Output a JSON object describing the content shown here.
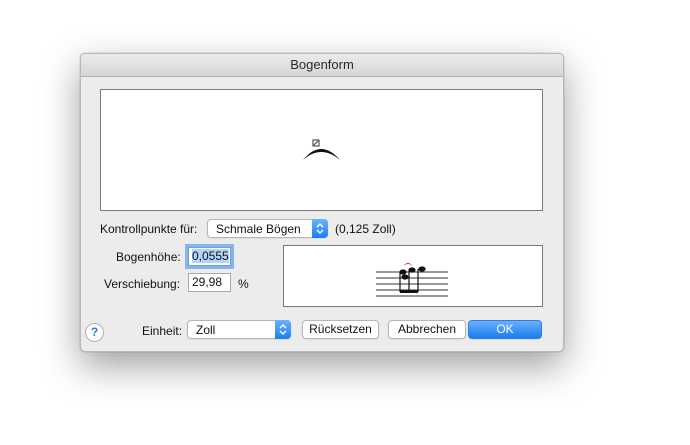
{
  "window": {
    "title": "Bogenform"
  },
  "controls": {
    "kontrollpunkte_label": "Kontrollpunkte für:",
    "kontrollpunkte_value": "Schmale Bögen",
    "kontrollpunkte_size": "(0,125 Zoll)",
    "bogenhoehe_label": "Bogenhöhe:",
    "bogenhoehe_value": "0,0555",
    "verschiebung_label": "Verschiebung:",
    "verschiebung_value": "29,98",
    "verschiebung_unit": "%",
    "einheit_label": "Einheit:",
    "einheit_value": "Zoll"
  },
  "buttons": {
    "help": "?",
    "reset": "Rücksetzen",
    "cancel": "Abbrechen",
    "ok": "OK"
  },
  "colors": {
    "accent": "#1c7ef2",
    "slur_handle": "#d9231d"
  },
  "icons": [
    "chevron-updown-icon",
    "help-icon",
    "slur-preview",
    "notes-preview"
  ]
}
